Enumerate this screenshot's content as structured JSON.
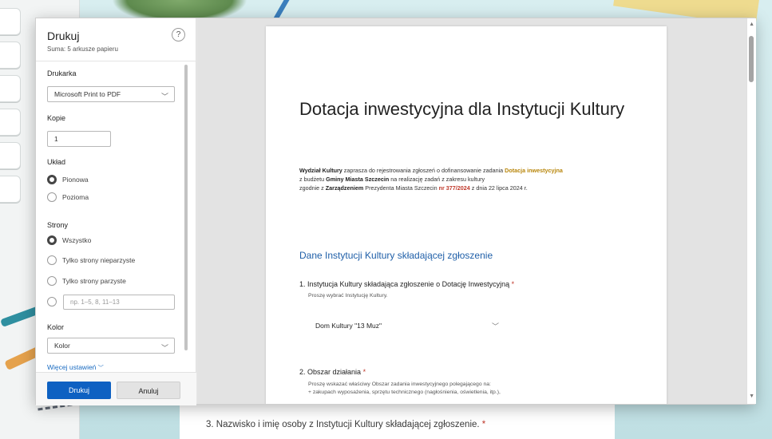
{
  "dialog": {
    "title": "Drukuj",
    "subtitle": "Suma: 5 arkusze papieru",
    "help_glyph": "?",
    "printer_label": "Drukarka",
    "printer_value": "Microsoft Print to PDF",
    "copies_label": "Kopie",
    "copies_value": "1",
    "layout_label": "Układ",
    "layout_options": [
      "Pionowa",
      "Pozioma"
    ],
    "layout_selected": "Pionowa",
    "pages_label": "Strony",
    "pages_options": [
      "Wszystko",
      "Tylko strony nieparzyste",
      "Tylko strony parzyste"
    ],
    "pages_selected": "Wszystko",
    "pages_range_placeholder": "np. 1–5, 8, 11–13",
    "color_label": "Kolor",
    "color_value": "Kolor",
    "more_settings": "Więcej ustawień",
    "print_button": "Drukuj",
    "cancel_button": "Anuluj"
  },
  "document": {
    "title": "Dotacja inwestycyjna dla Instytucji Kultury",
    "intro": {
      "dept": "Wydział Kultury",
      "p1": " zaprasza do rejestrowania zgłoszeń o dofinansowanie zadania ",
      "grant": "Dotacja inwestycyjna",
      "p2": "z budżetu ",
      "city": "Gminy Miasta Szczecin",
      "p3": " na realizację zadań z zakresu kultury",
      "p4": "zgodnie z ",
      "decree": "Zarządzeniem",
      "p5": " Prezydenta Miasta Szczecin ",
      "number": "nr 377/2024",
      "p6": " z dnia 22 lipca 2024 r."
    },
    "section_title": "Dane Instytucji Kultury składającej zgłoszenie",
    "q1": "1. Instytucja Kultury składająca zgłoszenie o Dotację Inwestycyjną",
    "q1_hint": "Proszę wybrać Instytucję Kultury.",
    "q1_value": "Dom Kultury \"13 Muz\"",
    "q2": "2. Obszar działania",
    "q2_hint_1": "Proszę wskazać właściwy Obszar zadania inwestycyjnego polegającego na:",
    "q2_hint_2": "+ zakupach wyposażenia, sprzętu technicznego (nagłośnienia, oświetlenia, itp.),",
    "required_mark": "*"
  },
  "behind": {
    "q3": "3. Nazwisko i imię osoby z Instytucji Kultury składającej zgłoszenie."
  },
  "colors": {
    "accent": "#0e61c2",
    "section": "#1f5fa8",
    "required": "#c0392b",
    "highlight": "#b8860b"
  }
}
